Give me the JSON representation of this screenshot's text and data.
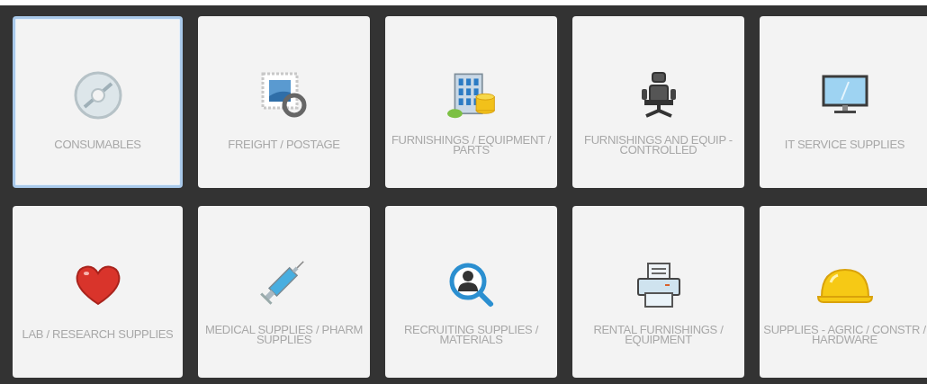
{
  "categories": [
    {
      "label": "CONSUMABLES",
      "kind": "disc",
      "selected": true
    },
    {
      "label": "FREIGHT / POSTAGE",
      "kind": "stamp",
      "selected": false
    },
    {
      "label": "FURNISHINGS / EQUIPMENT / PARTS",
      "kind": "building",
      "selected": false
    },
    {
      "label": "FURNISHINGS AND EQUIP - CONTROLLED",
      "kind": "chair",
      "selected": false
    },
    {
      "label": "IT SERVICE SUPPLIES",
      "kind": "monitor",
      "selected": false
    },
    {
      "label": "LAB / RESEARCH SUPPLIES",
      "kind": "heart",
      "selected": false
    },
    {
      "label": "MEDICAL SUPPLIES / PHARM SUPPLIES",
      "kind": "syringe",
      "selected": false
    },
    {
      "label": "RECRUITING SUPPLIES / MATERIALS",
      "kind": "person-search",
      "selected": false
    },
    {
      "label": "RENTAL FURNISHINGS / EQUIPMENT",
      "kind": "printer",
      "selected": false
    },
    {
      "label": "SUPPLIES - AGRIC / CONSTR / HARDWARE",
      "kind": "helmet",
      "selected": false
    }
  ]
}
